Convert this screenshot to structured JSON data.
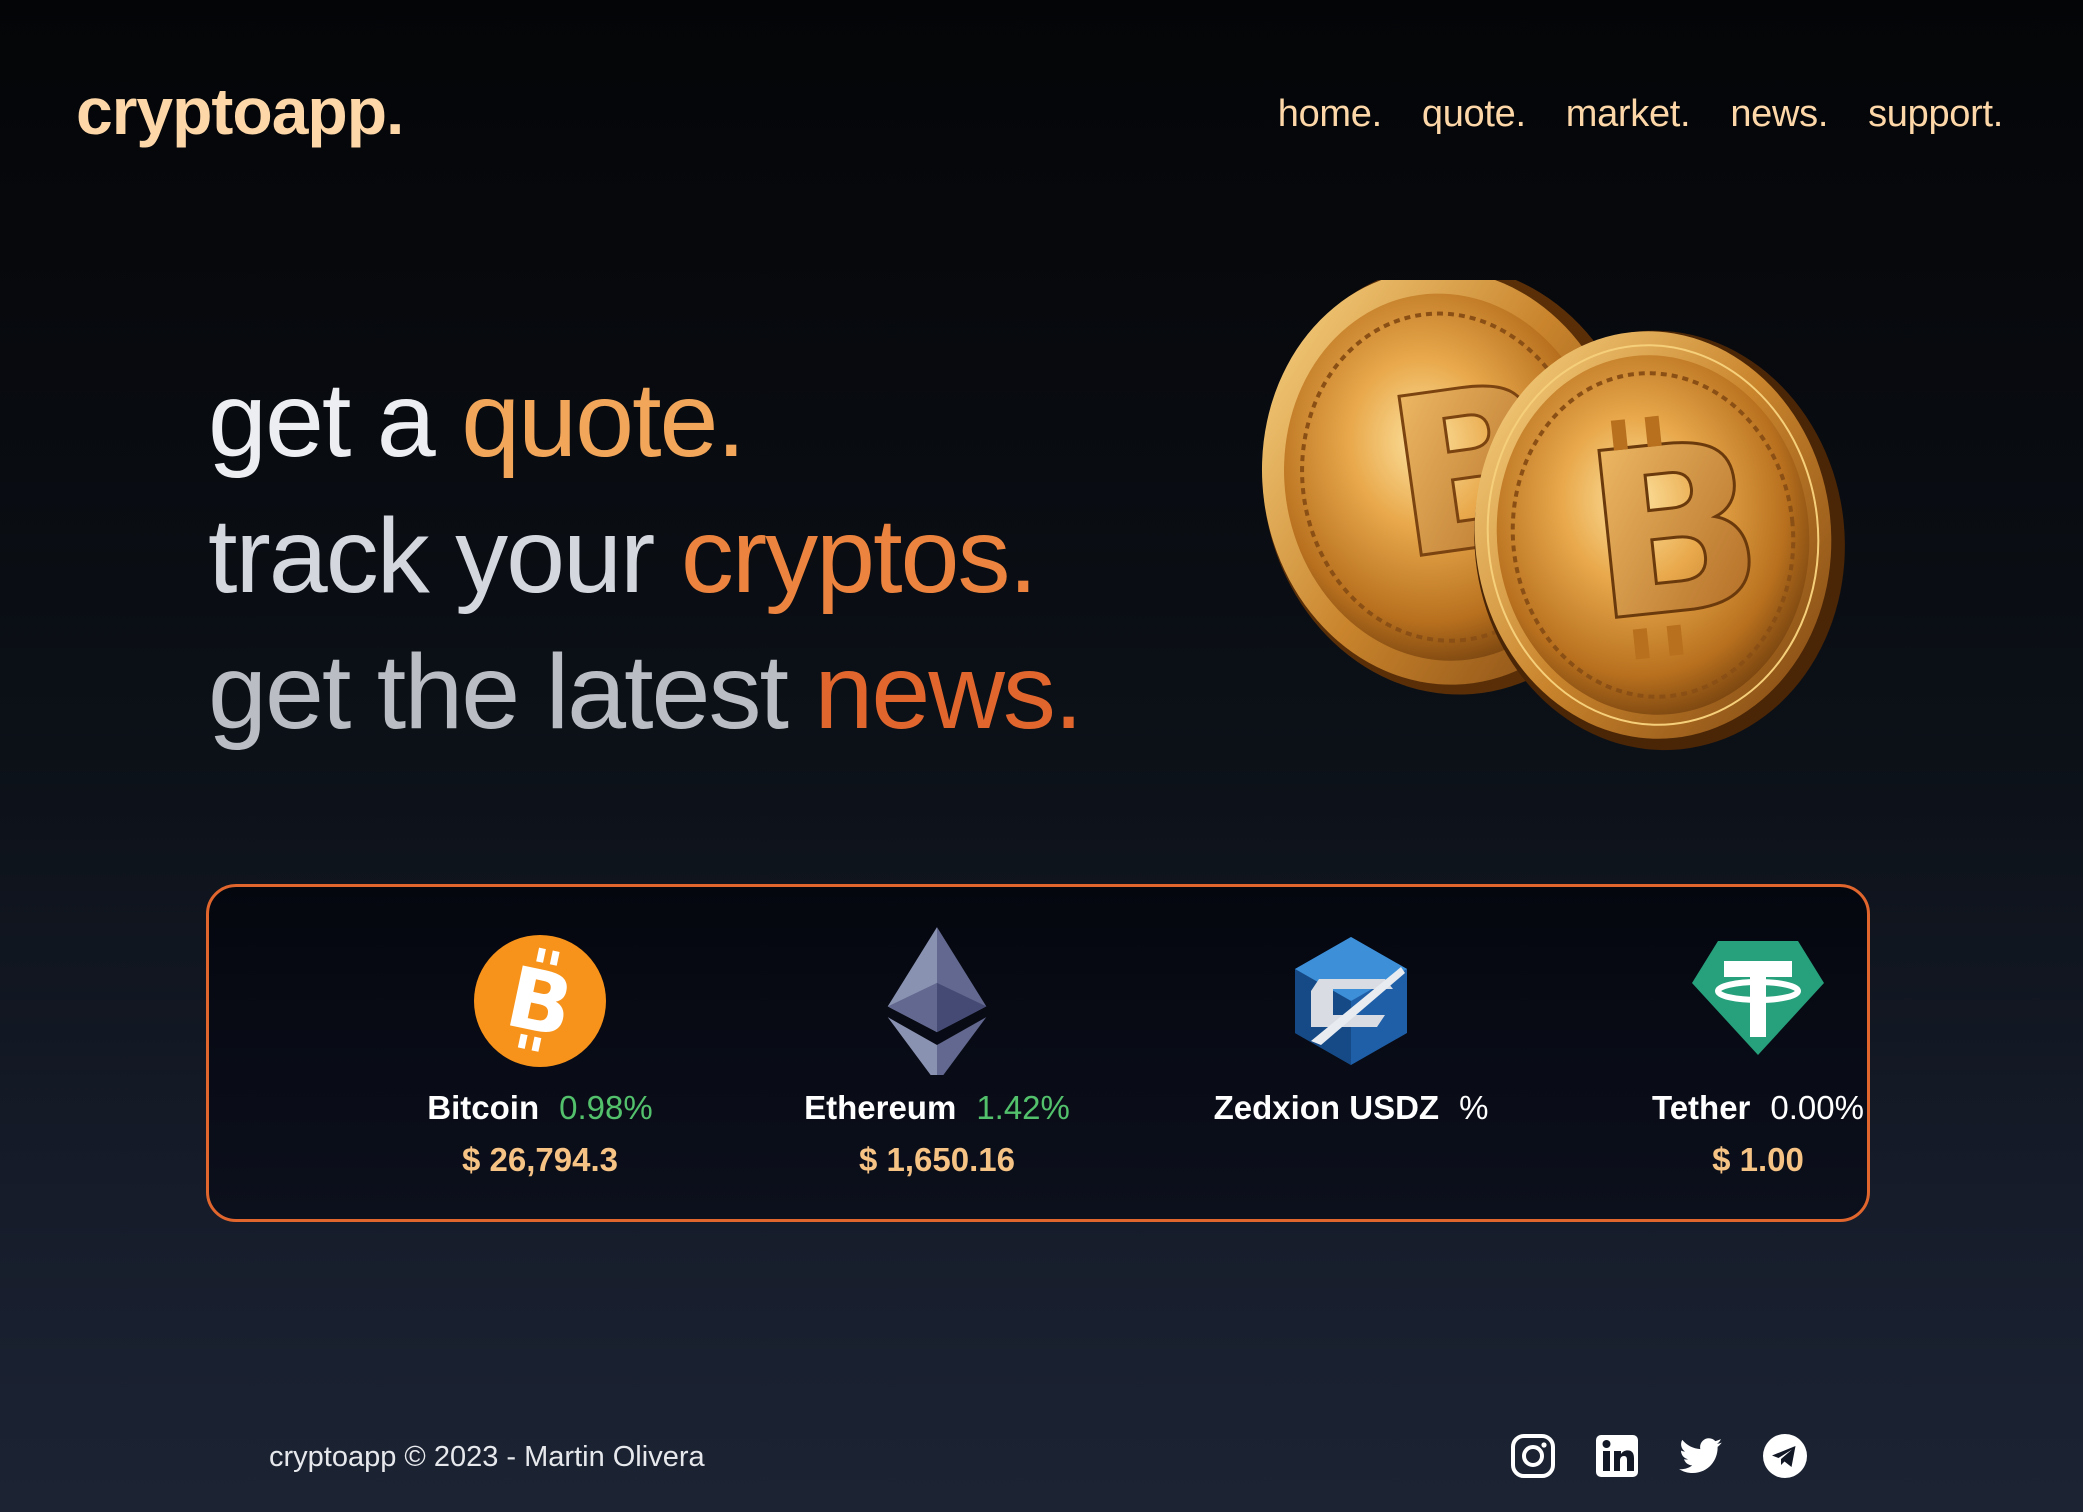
{
  "header": {
    "logo": "cryptoapp.",
    "nav": [
      "home.",
      "quote.",
      "market.",
      "news.",
      "support."
    ]
  },
  "hero": {
    "line1_lead": "get a ",
    "line1_accent": "quote.",
    "line2_lead": "track your ",
    "line2_accent": "cryptos.",
    "line3_lead": "get the latest ",
    "line3_accent": "news."
  },
  "ticker": {
    "coins": [
      {
        "name": "Bitcoin",
        "change": "0.98%",
        "price": "$ 26,794.3",
        "icon": "bitcoin-icon",
        "trend": "up"
      },
      {
        "name": "Ethereum",
        "change": "1.42%",
        "price": "$ 1,650.16",
        "icon": "ethereum-icon",
        "trend": "up"
      },
      {
        "name": "Zedxion USDZ",
        "change": "%",
        "price": "",
        "icon": "zedxion-icon",
        "trend": "flat"
      },
      {
        "name": "Tether",
        "change": "0.00%",
        "price": "$ 1.00",
        "icon": "tether-icon",
        "trend": "flat"
      }
    ]
  },
  "footer": {
    "text": "cryptoapp © 2023 - Martin Olivera",
    "socials": [
      "instagram-icon",
      "linkedin-icon",
      "twitter-icon",
      "telegram-icon"
    ]
  },
  "colors": {
    "accent": "#e0662e",
    "logo": "#fdd7a8",
    "positive": "#53c16c",
    "price": "#f6c384"
  }
}
